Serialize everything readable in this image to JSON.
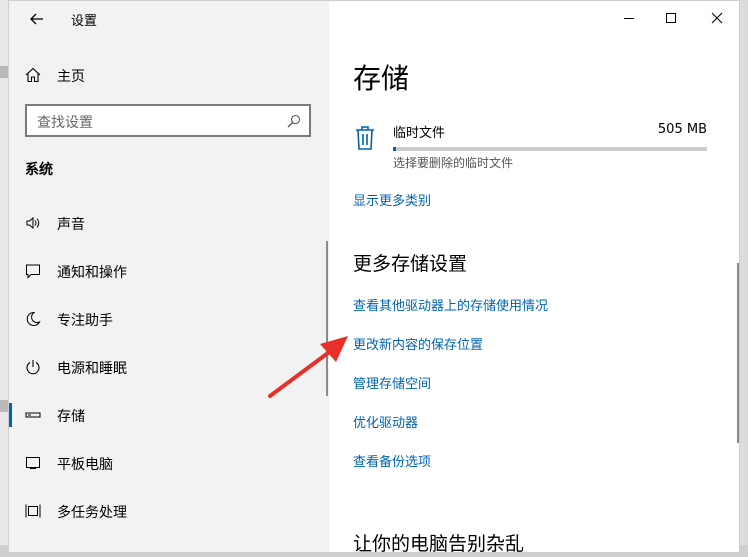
{
  "window": {
    "title": "设置",
    "controls": [
      "minimize",
      "maximize",
      "close"
    ]
  },
  "sidebar": {
    "home_label": "主页",
    "search_placeholder": "查找设置",
    "section_label": "系统",
    "items": [
      {
        "label": "声音",
        "icon": "speaker-icon",
        "active": false
      },
      {
        "label": "通知和操作",
        "icon": "notification-icon",
        "active": false
      },
      {
        "label": "专注助手",
        "icon": "moon-icon",
        "active": false
      },
      {
        "label": "电源和睡眠",
        "icon": "power-icon",
        "active": false
      },
      {
        "label": "存储",
        "icon": "storage-icon",
        "active": true
      },
      {
        "label": "平板电脑",
        "icon": "tablet-icon",
        "active": false
      },
      {
        "label": "多任务处理",
        "icon": "multitask-icon",
        "active": false
      }
    ]
  },
  "main": {
    "page_title": "存储",
    "temp_files": {
      "label": "临时文件",
      "size": "505 MB",
      "description": "选择要删除的临时文件",
      "usage_fraction": 0.01
    },
    "show_more_link": "显示更多类别",
    "more_settings_heading": "更多存储设置",
    "links": [
      "查看其他驱动器上的存储使用情况",
      "更改新内容的保存位置",
      "管理存储空间",
      "优化驱动器",
      "查看备份选项"
    ],
    "bottom_heading": "让你的电脑告别杂乱"
  },
  "annotation": {
    "arrow_color": "#e8302a"
  },
  "colors": {
    "accent": "#0063b1",
    "sidebar_bg": "#f2f2f2"
  }
}
